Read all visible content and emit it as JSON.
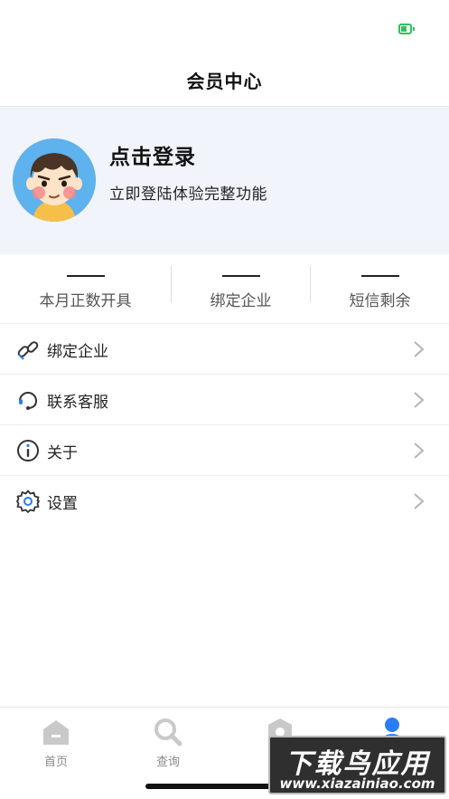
{
  "header": {
    "title": "会员中心"
  },
  "profile": {
    "login_title": "点击登录",
    "login_subtitle": "立即登陆体验完整功能"
  },
  "stats": [
    {
      "value": "—",
      "label": "本月正数开具"
    },
    {
      "value": "—",
      "label": "绑定企业"
    },
    {
      "value": "—",
      "label": "短信剩余"
    }
  ],
  "menu": [
    {
      "label": "绑定企业",
      "icon": "link-icon"
    },
    {
      "label": "联系客服",
      "icon": "headset-icon"
    },
    {
      "label": "关于",
      "icon": "info-icon"
    },
    {
      "label": "设置",
      "icon": "gear-icon"
    }
  ],
  "tabs": [
    {
      "label": "首页",
      "icon": "home-icon"
    },
    {
      "label": "查询",
      "icon": "search-icon"
    },
    {
      "label": "",
      "icon": "scan-icon"
    },
    {
      "label": "",
      "icon": "user-icon",
      "active": true
    }
  ],
  "watermark": {
    "text": "下载鸟应用",
    "url": "www.xiazainiao.com"
  },
  "colors": {
    "accent": "#2b7cf6",
    "profile_bg": "#f1f4fb",
    "battery": "#2ec45a"
  }
}
